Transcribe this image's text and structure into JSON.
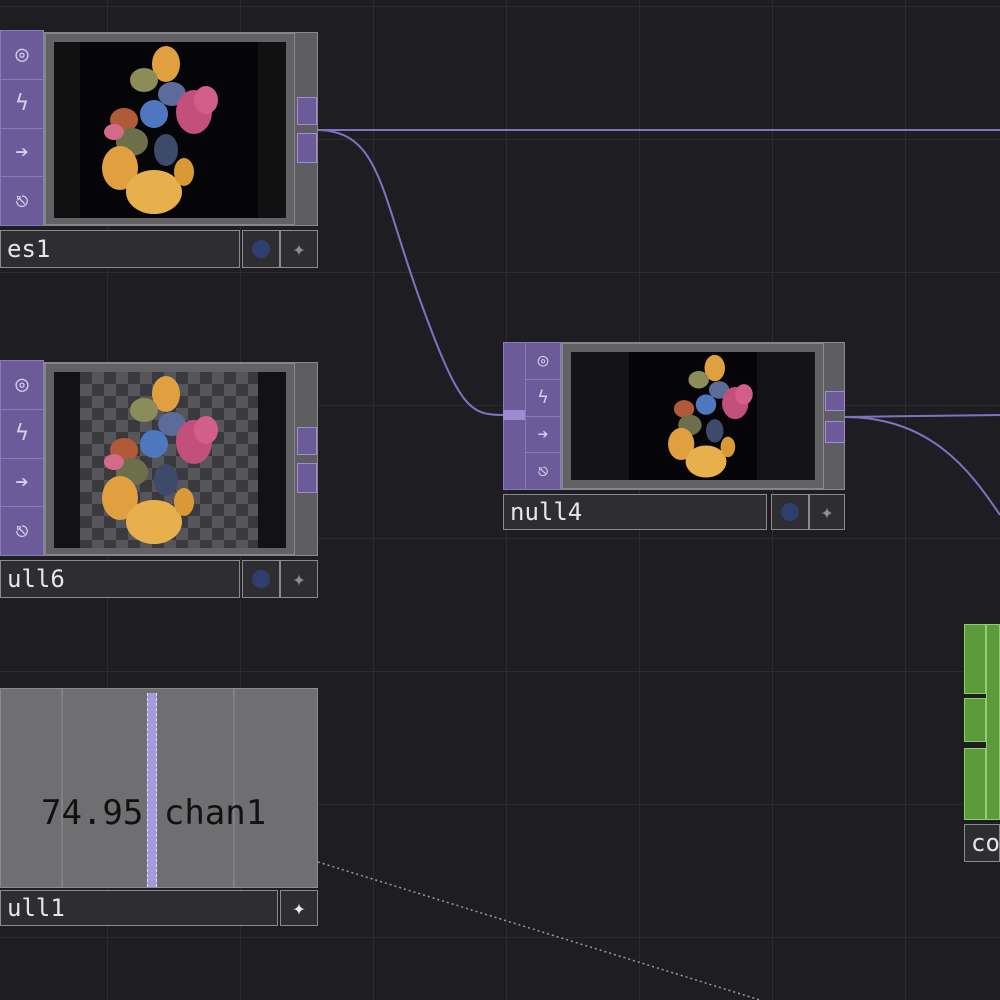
{
  "colors": {
    "background": "#1e1e22",
    "top_accent": "#6c5b99",
    "wire": "#7f72c2",
    "chop_accent": "#5c9a3c"
  },
  "nodes": {
    "top_left": {
      "label": "es1",
      "icons": [
        "viewer-icon",
        "bypass-icon",
        "arrow-icon",
        "lock-icon"
      ]
    },
    "mid_left": {
      "label": "ull6"
    },
    "center": {
      "label": "null4"
    },
    "chop": {
      "label": "ull1",
      "value_text": "74.95",
      "channel": "chan1"
    },
    "right_green": {
      "label": "co"
    }
  },
  "icons": {
    "viewer": "◎",
    "bypass": "ϟ",
    "arrow": "➔",
    "lock": "🔓",
    "star": "✦"
  }
}
